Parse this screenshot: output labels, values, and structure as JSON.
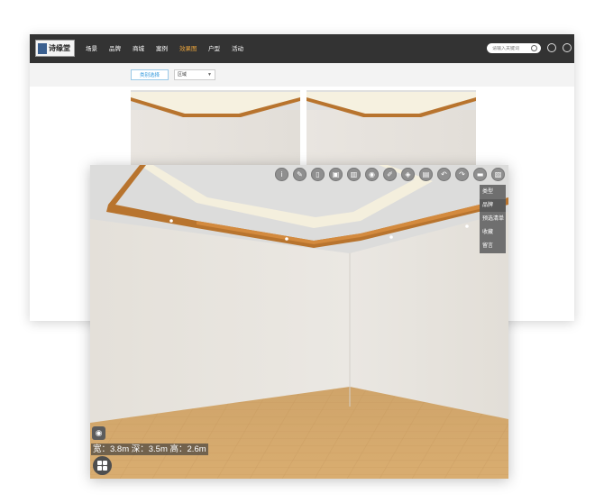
{
  "site": {
    "logo_text": "诗缘堂",
    "nav": [
      {
        "label": "场景",
        "active": false
      },
      {
        "label": "品牌",
        "active": false
      },
      {
        "label": "商城",
        "active": false
      },
      {
        "label": "案例",
        "active": false
      },
      {
        "label": "效果图",
        "active": true
      },
      {
        "label": "户型",
        "active": false
      },
      {
        "label": "活动",
        "active": false
      }
    ],
    "search_placeholder": "请输入关键词",
    "filter_button": "类别选择",
    "filter_select": "区域",
    "colors": {
      "nav_bg": "#333333",
      "active": "#e6a23c",
      "accent": "#3399dd"
    }
  },
  "viewer": {
    "toolbar_icons": [
      "info-icon",
      "pencil-icon",
      "door-icon",
      "floor-plan-icon",
      "wall-icon",
      "camera-icon",
      "edit-icon",
      "transform-icon",
      "save-icon",
      "undo-icon",
      "redo-icon",
      "delete-icon",
      "image-icon"
    ],
    "side_menu": [
      {
        "label": "类型",
        "active": false
      },
      {
        "label": "品牌",
        "active": true
      },
      {
        "label": "预选清单",
        "active": false
      },
      {
        "label": "收藏",
        "active": false
      },
      {
        "label": "留言",
        "active": false
      }
    ],
    "dimensions": "宽：3.8m 深：3.5m 高：2.6m",
    "colors": {
      "wall": "#e8e4de",
      "ceiling": "#dcdcdb",
      "wood_trim": "#b8742e",
      "floor": "#d8aa6c"
    }
  }
}
